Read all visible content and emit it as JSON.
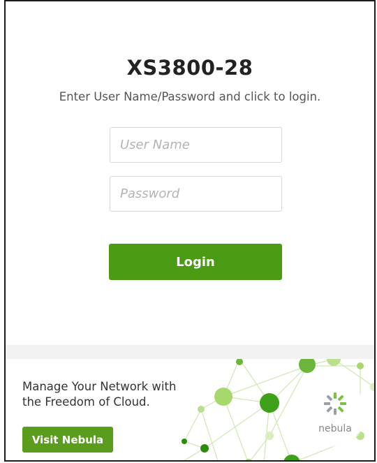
{
  "login": {
    "device_name": "XS3800-28",
    "instructions": "Enter User Name/Password and click to login.",
    "username_placeholder": "User Name",
    "password_placeholder": "Password",
    "login_label": "Login"
  },
  "promo": {
    "line1": "Manage Your Network with",
    "line2": "the Freedom of Cloud.",
    "button_label": "Visit Nebula",
    "brand_label": "nebula"
  },
  "colors": {
    "login_button": "#4a9a13",
    "visit_button": "#5a9c1c",
    "network_green": "#7cc242"
  },
  "icons": {
    "brand": "nebula-logo-icon",
    "art": "network-graph-icon"
  }
}
